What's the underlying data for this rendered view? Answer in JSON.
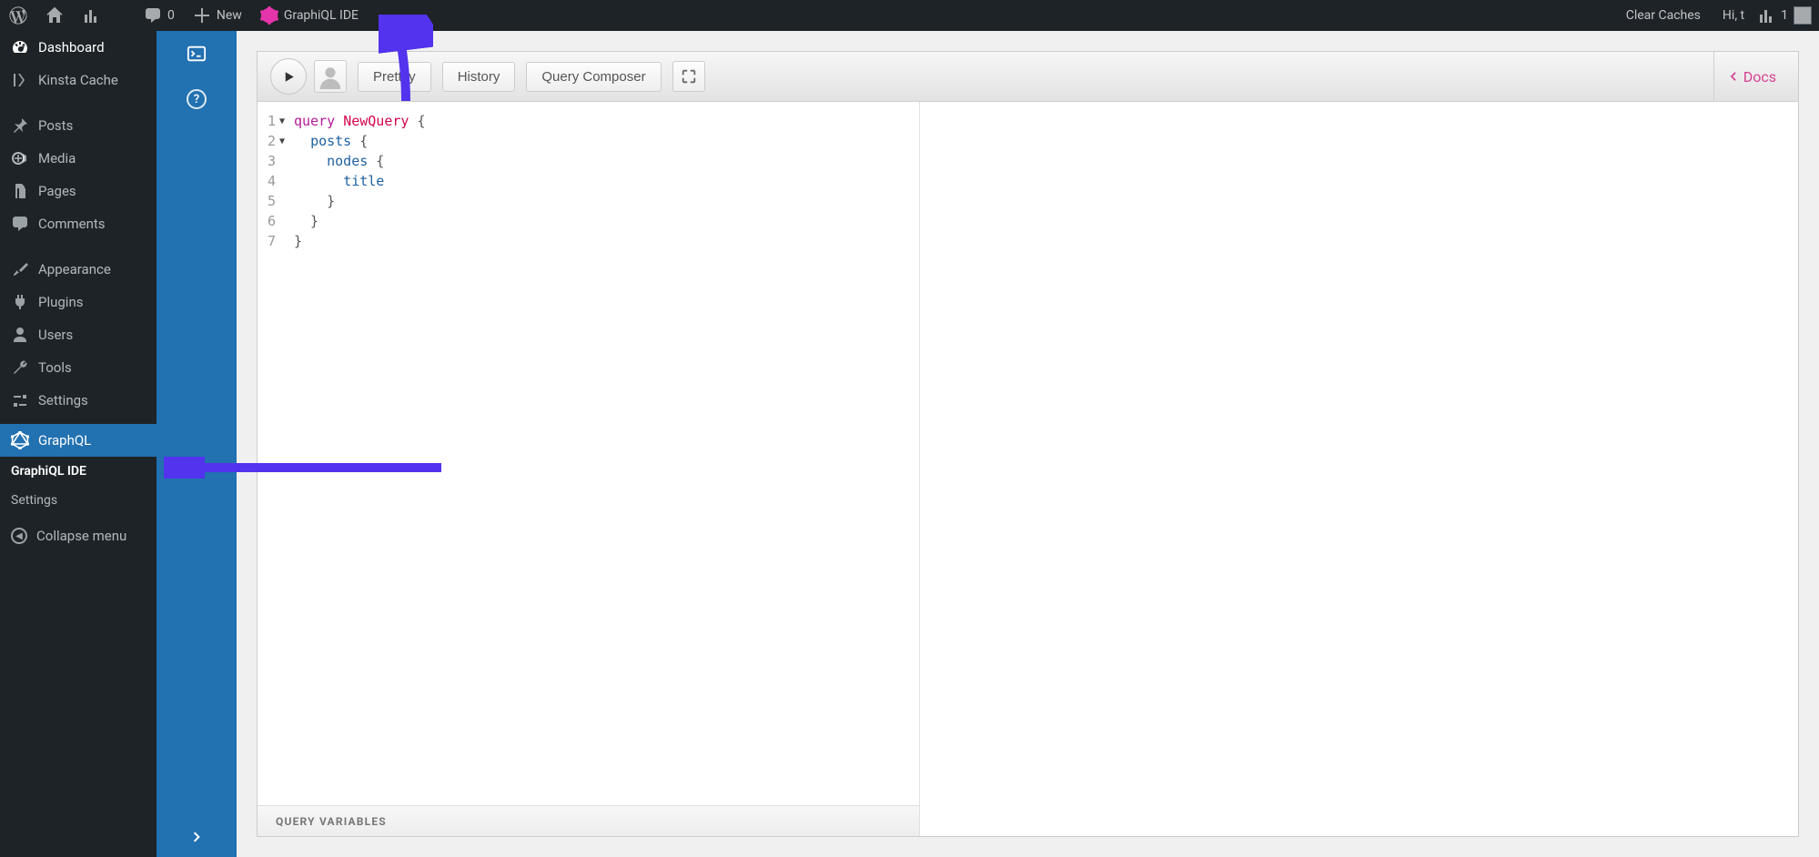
{
  "adminbar": {
    "comments": "0",
    "new": "New",
    "graphiql": "GraphiQL IDE",
    "clearCaches": "Clear Caches",
    "greeting": "Hi, t"
  },
  "sidebar": {
    "dashboard": "Dashboard",
    "kinsta": "Kinsta Cache",
    "posts": "Posts",
    "media": "Media",
    "pages": "Pages",
    "comments": "Comments",
    "appearance": "Appearance",
    "plugins": "Plugins",
    "users": "Users",
    "tools": "Tools",
    "settings": "Settings",
    "graphql": "GraphQL",
    "submenu": {
      "ide": "GraphiQL IDE",
      "settings": "Settings"
    },
    "collapse": "Collapse menu"
  },
  "toolbar": {
    "prettify": "Prettify",
    "history": "History",
    "composer": "Query Composer",
    "docs": "Docs"
  },
  "editor": {
    "lineNumbers": [
      "1",
      "2",
      "3",
      "4",
      "5",
      "6",
      "7"
    ],
    "kwQuery": "query",
    "queryName": "NewQuery",
    "posts": "posts",
    "nodes": "nodes",
    "title": "title",
    "brace_open": " {",
    "brace_close_3": "    }",
    "brace_close_2": "  }",
    "brace_close_1": "}",
    "varsLabel": "QUERY VARIABLES"
  }
}
